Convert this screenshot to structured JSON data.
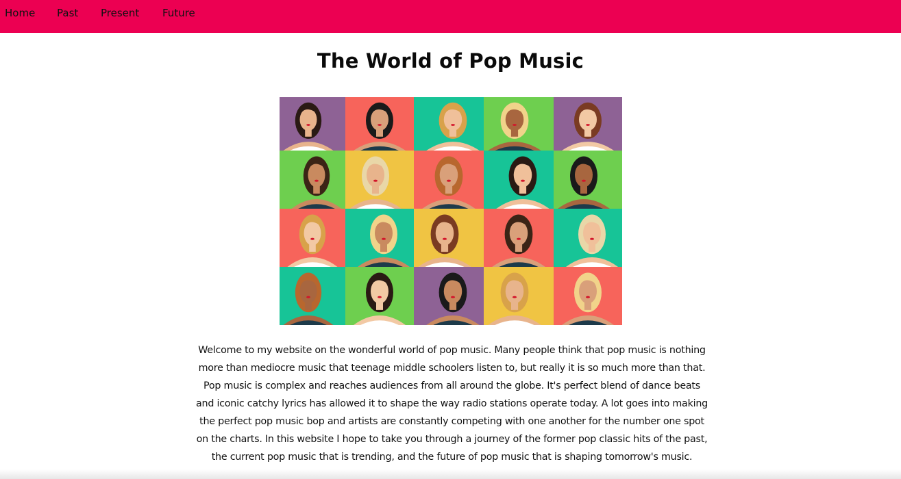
{
  "nav": {
    "items": [
      {
        "label": "Home"
      },
      {
        "label": "Past"
      },
      {
        "label": "Present"
      },
      {
        "label": "Future"
      }
    ],
    "bg_color": "#ec0052"
  },
  "page": {
    "title": "The World of Pop Music"
  },
  "hero_image": {
    "description_icon": "pop-artists-collage-image",
    "tile_colors": [
      [
        "#8e6295",
        "#f7645b",
        "#17c497",
        "#6ecf4f",
        "#8e6295"
      ],
      [
        "#6ecf4f",
        "#f0c443",
        "#f7645b",
        "#17c497",
        "#6ecf4f"
      ],
      [
        "#f7645b",
        "#17c497",
        "#f0c443",
        "#f7645b",
        "#17c497"
      ],
      [
        "#17c497",
        "#6ecf4f",
        "#8e6295",
        "#f0c443",
        "#f7645b"
      ]
    ]
  },
  "intro": {
    "text": "Welcome to my website on the wonderful world of pop music. Many people think that pop music is nothing more than mediocre music that teenage middle schoolers listen to, but really it is so much more than that. Pop music is complex and reaches audiences from all around the globe. It's perfect blend of dance beats and iconic catchy lyrics has allowed it to shape the way radio stations operate today. A lot goes into making the perfect pop music bop and artists are constantly competing with one another for the number one spot on the charts. In this website I hope to take you through a journey of the former pop classic hits of the past, the current pop music that is trending, and the future of pop music that is shaping tomorrow's music."
  }
}
